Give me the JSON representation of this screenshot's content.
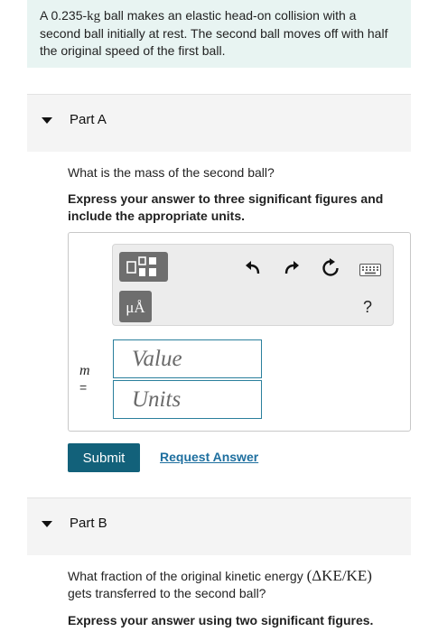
{
  "problem": {
    "pre": "A 0.235-",
    "unit": "kg",
    "post": " ball makes an elastic head-on collision with a second ball initially at rest. The second ball moves off with half the original speed of the first ball."
  },
  "part_a": {
    "label": "Part A",
    "question": "What is the mass of the second ball?",
    "instruction": "Express your answer to three significant figures and include the appropriate units.",
    "toolbar": {
      "mu_label": "μÅ",
      "help_label": "?"
    },
    "variable": "m",
    "equals": "=",
    "value_placeholder": "Value",
    "units_placeholder": "Units",
    "submit_label": "Submit",
    "request_label": "Request Answer"
  },
  "part_b": {
    "label": "Part B",
    "question_pre": "What fraction of the original kinetic energy ",
    "question_math": "(ΔKE/KE)",
    "question_post": "gets transferred to the second ball?",
    "instruction": "Express your answer using two significant figures."
  },
  "colors": {
    "problem_bg": "#e8f4f2",
    "submit_bg": "#12617a",
    "link": "#1e6f9f",
    "field_border": "#2a7f9c"
  }
}
